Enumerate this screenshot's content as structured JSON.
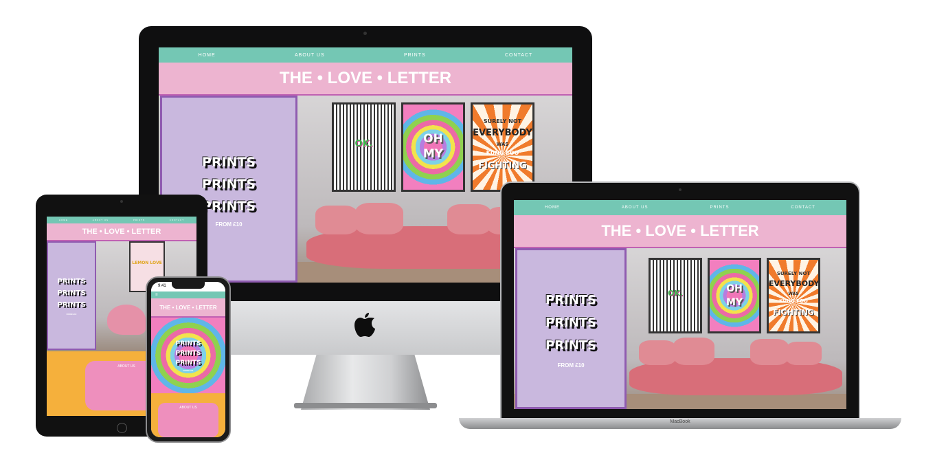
{
  "site": {
    "nav": [
      "HOME",
      "ABOUT US",
      "PRINTS",
      "CONTACT"
    ],
    "title": "THE • LOVE • LETTER",
    "hero_words": [
      "PRINTS",
      "PRINTS",
      "PRINTS"
    ],
    "price": "FROM £10",
    "poster_stripes_text": "OK.",
    "poster_waves_text": [
      "OH",
      "MY"
    ],
    "poster_sunburst_text": [
      "SURELY NOT",
      "EVERYBODY",
      "WAS",
      "KUNG FOO",
      "FIGHTING"
    ],
    "about_title": "ABOUT US",
    "tablet_poster_text": "LEMON LOVE"
  },
  "devices": {
    "laptop_label": "MacBook",
    "phone_time": "9:41"
  },
  "colors": {
    "nav": "#74c7b4",
    "banner": "#edb4d0",
    "purple": "#c9b8de",
    "about_bg": "#f5b03c",
    "about_card": "#ee8fbd"
  }
}
